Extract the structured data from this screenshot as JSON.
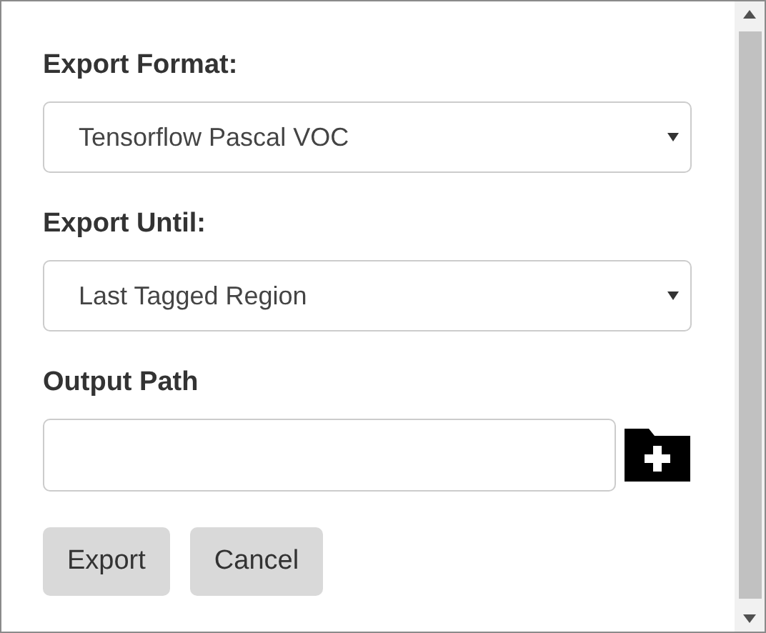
{
  "form": {
    "fields": [
      {
        "kind": "select",
        "label": "Export Format:",
        "value": "Tensorflow Pascal VOC"
      },
      {
        "kind": "select",
        "label": "Export Until:",
        "value": "Last Tagged Region"
      },
      {
        "kind": "path",
        "label": "Output Path"
      }
    ]
  },
  "buttons": [
    {
      "label": "Export"
    },
    {
      "label": "Cancel"
    }
  ]
}
